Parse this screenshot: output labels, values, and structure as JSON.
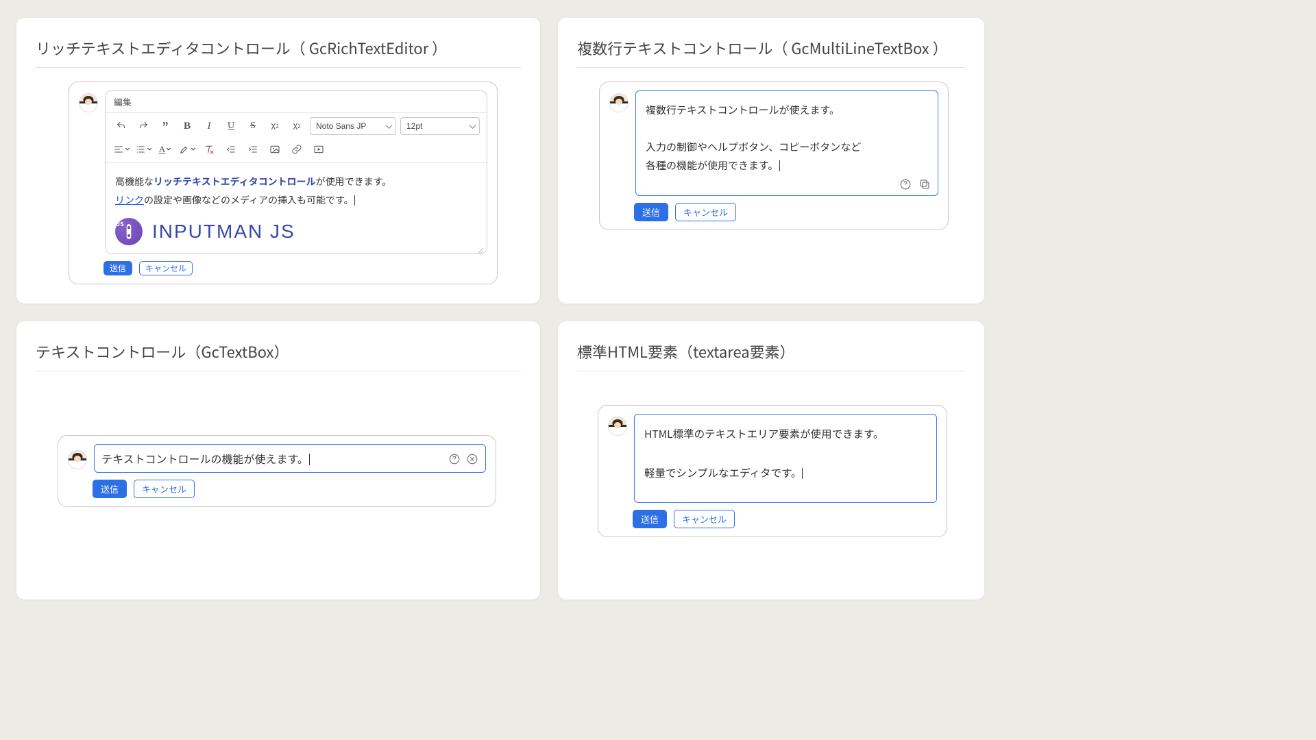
{
  "panels": {
    "richtext": {
      "title": "リッチテキストエディタコントロール（ GcRichTextEditor ）"
    },
    "multiline": {
      "title": "複数行テキストコントロール（ GcMultiLineTextBox ）"
    },
    "textbox": {
      "title": "テキストコントロール（GcTextBox）"
    },
    "textarea": {
      "title": "標準HTML要素（textarea要素）"
    }
  },
  "buttons": {
    "submit": "送信",
    "cancel": "キャンセル"
  },
  "rte": {
    "menubar": {
      "edit": "編集"
    },
    "font": {
      "family": "Noto Sans JP",
      "size": "12pt"
    },
    "content": {
      "line1_pre": "高機能な",
      "line1_bold": "リッチテキストエディタコントロール",
      "line1_post": "が使用できます。",
      "line2_link": "リンク",
      "line2_post": "の設定や画像などのメディアの挿入も可能です。"
    },
    "brand": {
      "badge": "JS",
      "text": "INPUTMAN JS"
    }
  },
  "multiline": {
    "line1": "複数行テキストコントロールが使えます。",
    "line2": "入力の制御やヘルプボタン、コピーボタンなど",
    "line3": "各種の機能が使用できます。"
  },
  "textbox": {
    "value": "テキストコントロールの機能が使えます。"
  },
  "textarea": {
    "line1": "HTML標準のテキストエリア要素が使用できます。",
    "line2": "軽量でシンプルなエディタです。"
  }
}
